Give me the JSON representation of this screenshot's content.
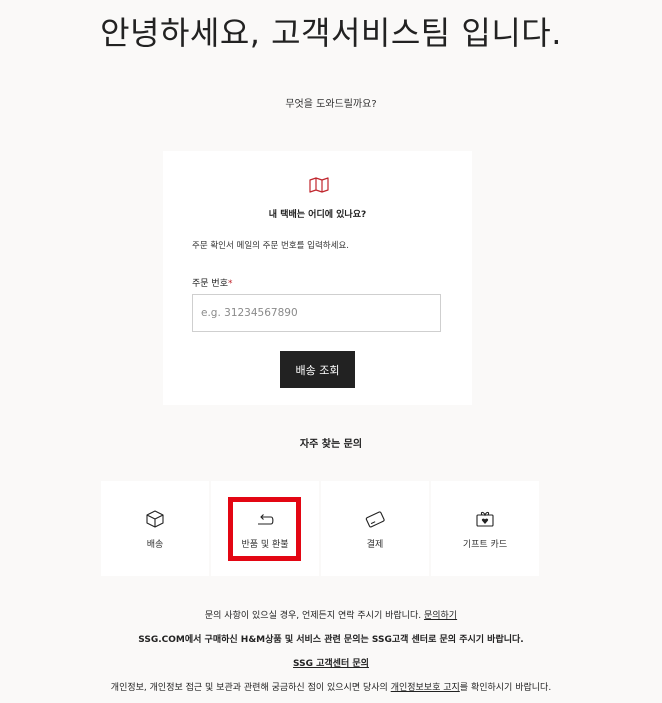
{
  "hero": {
    "title": "안녕하세요, 고객서비스팀 입니다.",
    "subtitle": "무엇을 도와드릴까요?"
  },
  "tracking_card": {
    "icon": "map-icon",
    "question": "내 택배는 어디에 있나요?",
    "instruction": "주문 확인서 메일의 주문 번호를 입력하세요.",
    "field_label": "주문 번호",
    "required_mark": "*",
    "input_placeholder": "e.g. 31234567890",
    "input_value": "",
    "button_label": "배송 조회"
  },
  "faq": {
    "title": "자주 찾는 문의",
    "tiles": [
      {
        "label": "배송",
        "icon": "box-icon"
      },
      {
        "label": "반품 및 환불",
        "icon": "return-arrow-icon"
      },
      {
        "label": "결제",
        "icon": "card-icon"
      },
      {
        "label": "기프트 카드",
        "icon": "gift-card-icon"
      }
    ]
  },
  "footer": {
    "line1_text": "문의 사항이 있으실 경우, 언제든지 연락 주시기 바랍니다.",
    "line1_link": "문의하기",
    "line2_text": "SSG.COM에서 구매하신 H&M상품 및 서비스 관련 문의는 SSG고객 센터로 문의 주시기 바랍니다.",
    "line3_link": "SSG 고객센터 문의",
    "line4_prefix": "개인정보, 개인정보 접근 및 보관과 관련해 궁금하신 점이 있으시면 당사의",
    "line4_link": "개인정보보호 고지",
    "line4_suffix": "를 확인하시기 바랍니다."
  },
  "colors": {
    "background": "#faf9f8",
    "card": "#ffffff",
    "button": "#222222",
    "accent_red": "#c0262d",
    "highlight": "#e30613"
  }
}
